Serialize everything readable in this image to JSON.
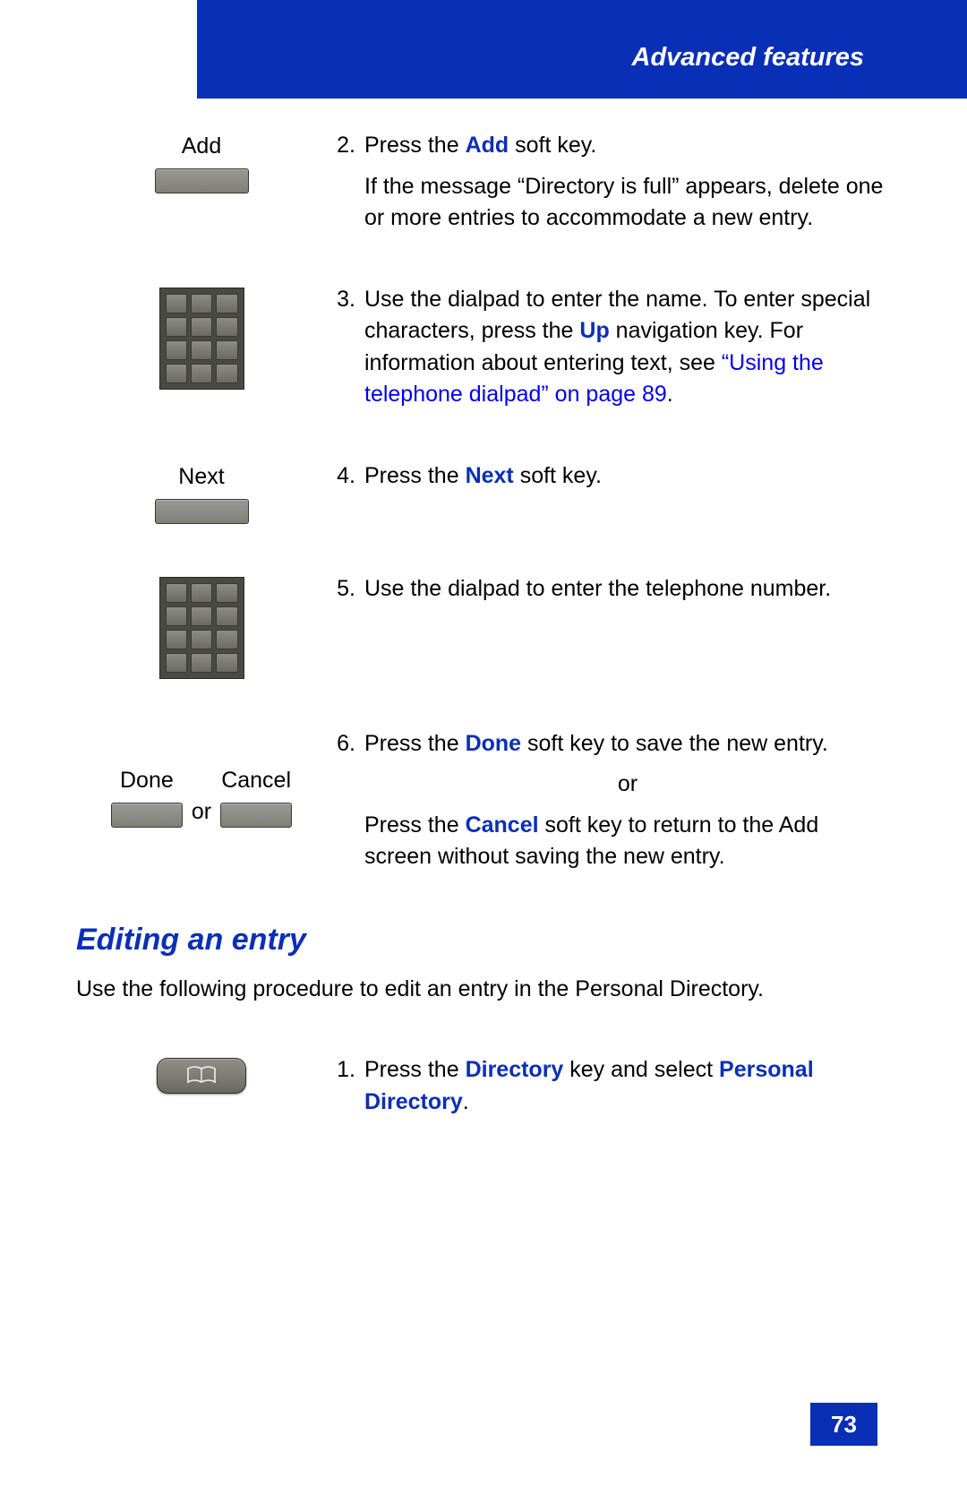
{
  "header": {
    "title": "Advanced features"
  },
  "steps": [
    {
      "softkey_label": "Add",
      "num": "2.",
      "lead_pre": "Press the ",
      "lead_bold": "Add",
      "lead_post": " soft key.",
      "extra": "If the message “Directory is full” appears, delete one or more entries to accommodate a new entry."
    },
    {
      "num": "3.",
      "text_a": "Use the dialpad to enter the name. To enter special characters, press the ",
      "bold_a": "Up",
      "text_b": " navigation key. For information about entering text, see ",
      "link": "“Using the telephone dialpad” on page 89",
      "text_c": "."
    },
    {
      "softkey_label": "Next",
      "num": "4.",
      "lead_pre": "Press the ",
      "lead_bold": "Next",
      "lead_post": " soft key."
    },
    {
      "num": "5.",
      "text": "Use the dialpad to enter the telephone number."
    },
    {
      "done_label": "Done",
      "cancel_label": "Cancel",
      "or_label": "or",
      "num": "6.",
      "p1_pre": "Press the ",
      "p1_bold": "Done",
      "p1_post": " soft key to save the new entry.",
      "or_center": "or",
      "p2_pre": "Press the ",
      "p2_bold": "Cancel",
      "p2_post": " soft key to return to the Add screen without saving the new entry."
    }
  ],
  "section": {
    "heading": "Editing an entry",
    "intro": "Use the following procedure to edit an entry in the Personal Directory."
  },
  "edit_step": {
    "num": "1.",
    "pre": "Press the ",
    "bold1": "Directory",
    "mid": " key and select ",
    "bold2": "Personal Directory",
    "post": "."
  },
  "page_number": "73"
}
